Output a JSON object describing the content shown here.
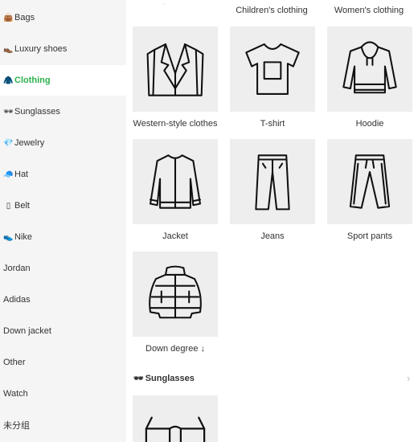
{
  "sidebar": {
    "items": [
      {
        "label": "Bags",
        "icon": "bag-icon",
        "glyph": "👜",
        "active": false
      },
      {
        "label": "Luxury shoes",
        "icon": "shoe-icon",
        "glyph": "👞",
        "active": false
      },
      {
        "label": "Clothing",
        "icon": "clothing-icon",
        "glyph": "🧥",
        "active": true
      },
      {
        "label": "Sunglasses",
        "icon": "sunglasses-icon",
        "glyph": "🕶",
        "active": false
      },
      {
        "label": "Jewelry",
        "icon": "gem-icon",
        "glyph": "💎",
        "active": false
      },
      {
        "label": "Hat",
        "icon": "cap-icon",
        "glyph": "🧢",
        "active": false
      },
      {
        "label": "Belt",
        "icon": "belt-icon",
        "glyph": "▯",
        "active": false
      },
      {
        "label": "Nike",
        "icon": "sneaker-icon",
        "glyph": "👟",
        "active": false
      },
      {
        "label": "Jordan",
        "icon": "",
        "glyph": "",
        "active": false
      },
      {
        "label": "Adidas",
        "icon": "",
        "glyph": "",
        "active": false
      },
      {
        "label": "Down jacket",
        "icon": "",
        "glyph": "",
        "active": false
      },
      {
        "label": "Other",
        "icon": "",
        "glyph": "",
        "active": false
      },
      {
        "label": "Watch",
        "icon": "",
        "glyph": "",
        "active": false
      },
      {
        "label": "未分组",
        "icon": "",
        "glyph": "",
        "active": false
      }
    ]
  },
  "main": {
    "top_labels": [
      "Children's clothing",
      "Women's clothing"
    ],
    "products": [
      {
        "label": "Western-style clothes",
        "icon": "suit-jacket-icon"
      },
      {
        "label": "T-shirt",
        "icon": "tshirt-icon"
      },
      {
        "label": "Hoodie",
        "icon": "hoodie-icon"
      },
      {
        "label": "Jacket",
        "icon": "bomber-jacket-icon"
      },
      {
        "label": "Jeans",
        "icon": "jeans-icon"
      },
      {
        "label": "Sport pants",
        "icon": "sport-pants-icon"
      },
      {
        "label": "Down degree ↓",
        "icon": "down-jacket-icon"
      }
    ],
    "section": {
      "title": "Sunglasses",
      "icon": "sunglasses-icon",
      "glyph": "🕶",
      "arrow": "›"
    }
  },
  "colors": {
    "accent": "#2bb24c",
    "sidebar_bg": "#f5f5f5",
    "tile_bg": "#eeeeee"
  }
}
